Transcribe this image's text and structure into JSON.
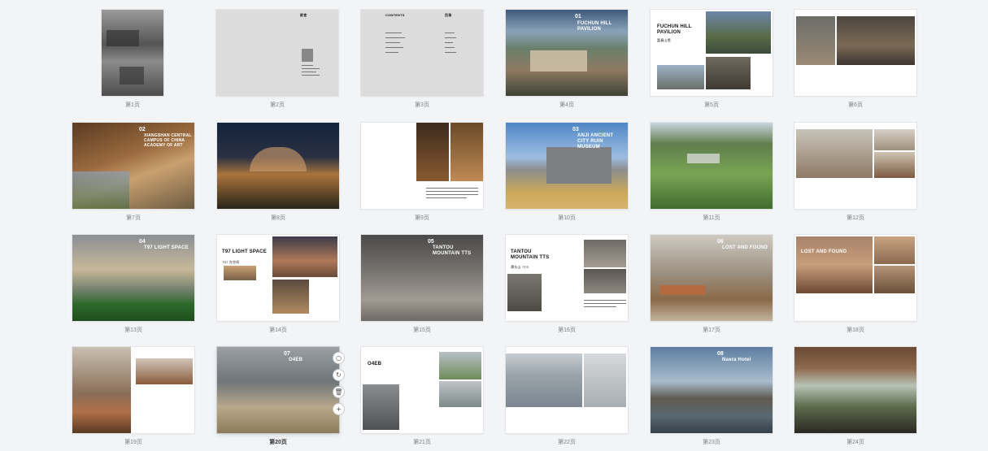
{
  "pages": [
    {
      "label": "第1页"
    },
    {
      "label": "第2页",
      "title": "前言"
    },
    {
      "label": "第3页",
      "title_left": "CONTENTS",
      "title_right": "目录"
    },
    {
      "label": "第4页",
      "num": "01",
      "title": "FUCHUN HILL PAVILION"
    },
    {
      "label": "第5页",
      "title": "FUCHUN HILL PAVILION",
      "subtitle": "富春山馆"
    },
    {
      "label": "第6页"
    },
    {
      "label": "第7页",
      "num": "02",
      "title": "XIANGSHAN CENTRAL CAMPUS OF CHINA ACADEMY OF ART"
    },
    {
      "label": "第8页"
    },
    {
      "label": "第9页"
    },
    {
      "label": "第10页",
      "num": "03",
      "title": "ANJI ANCIENT CITY RUIN MUSEUM"
    },
    {
      "label": "第11页"
    },
    {
      "label": "第12页"
    },
    {
      "label": "第13页",
      "num": "04",
      "title": "T97 LIGHT SPACE"
    },
    {
      "label": "第14页",
      "title": "T97 LIGHT SPACE",
      "subtitle": "T97 光空间"
    },
    {
      "label": "第15页",
      "num": "05",
      "title": "TANTOU MOUNTAIN TTS"
    },
    {
      "label": "第16页",
      "title": "TANTOU MOUNTAIN TTS",
      "subtitle": "潭头山 TTS"
    },
    {
      "label": "第17页",
      "num": "06",
      "title": "LOST AND FOUND"
    },
    {
      "label": "第18页",
      "title": "LOST AND FOUND"
    },
    {
      "label": "第19页"
    },
    {
      "label": "第20页",
      "num": "07",
      "title": "O4EB"
    },
    {
      "label": "第21页",
      "title": "O4EB"
    },
    {
      "label": "第22页"
    },
    {
      "label": "第23页",
      "num": "08",
      "title": "Naera Hotel"
    },
    {
      "label": "第24页"
    }
  ],
  "active_page": "第20页",
  "toolbar": [
    {
      "icon": "comment-icon",
      "glyph": "○"
    },
    {
      "icon": "rotate-icon",
      "glyph": "↻"
    },
    {
      "icon": "delete-icon",
      "glyph": "🗑"
    },
    {
      "icon": "add-icon",
      "glyph": "+"
    }
  ]
}
